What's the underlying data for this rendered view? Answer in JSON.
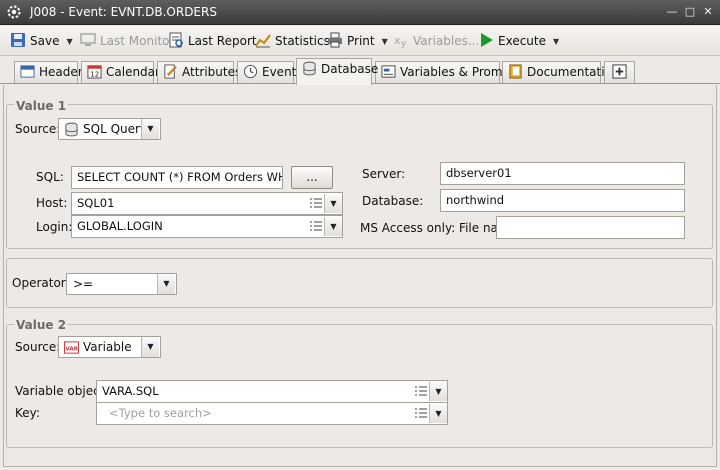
{
  "window": {
    "title": "J008 - Event: EVNT.DB.ORDERS"
  },
  "toolbar": {
    "save": "Save",
    "last_monitor": "Last Monitor",
    "last_report": "Last Report",
    "statistics": "Statistics",
    "print": "Print",
    "variables": "Variables...",
    "execute": "Execute"
  },
  "tabs": [
    "Header",
    "Calendar",
    "Attributes",
    "Event",
    "Database",
    "Variables & Prompts",
    "Documentation"
  ],
  "active_tab": "Database",
  "value1": {
    "title": "Value 1",
    "source_label": "Source:",
    "source_value": "SQL Query",
    "sql_label": "SQL:",
    "sql_value": "SELECT COUNT (*) FROM Orders WHERE",
    "sql_button": "...",
    "host_label": "Host:",
    "host_value": "SQL01",
    "login_label": "Login:",
    "login_value": "GLOBAL.LOGIN",
    "server_label": "Server:",
    "server_value": "dbserver01",
    "database_label": "Database:",
    "database_value": "northwind",
    "msaccess_label": "MS Access only: File name:",
    "msaccess_value": ""
  },
  "operator": {
    "label": "Operator:",
    "value": ">="
  },
  "value2": {
    "title": "Value 2",
    "source_label": "Source:",
    "source_value": "Variable",
    "varobj_label": "Variable object:",
    "varobj_value": "VARA.SQL",
    "key_label": "Key:",
    "key_placeholder": "<Type to search>"
  },
  "colors": {
    "titlebar": "#4a4a4a",
    "background": "#ece9e6",
    "execute_green": "#1f9a2a"
  }
}
